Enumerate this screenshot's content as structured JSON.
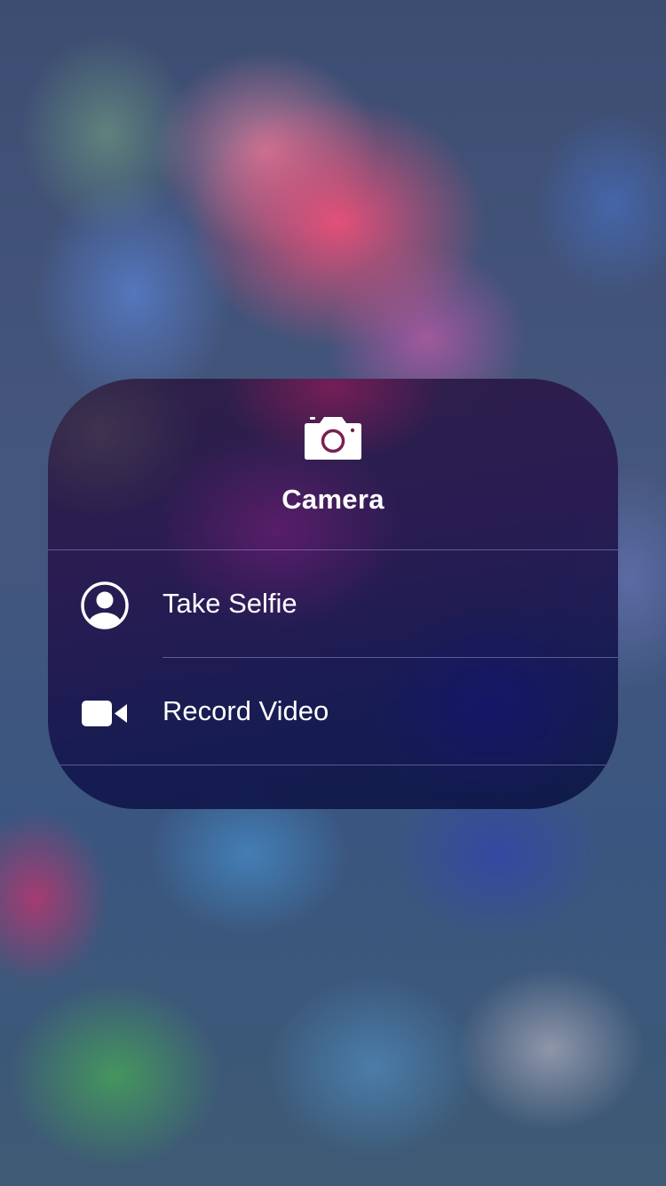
{
  "menu": {
    "app_name": "Camera",
    "app_icon": "camera-icon",
    "actions": [
      {
        "label": "Take Selfie",
        "icon": "person-circle-icon"
      },
      {
        "label": "Record Video",
        "icon": "video-camera-icon"
      }
    ]
  },
  "colors": {
    "text": "#ffffff",
    "icon_accent": "#7a1f52"
  }
}
